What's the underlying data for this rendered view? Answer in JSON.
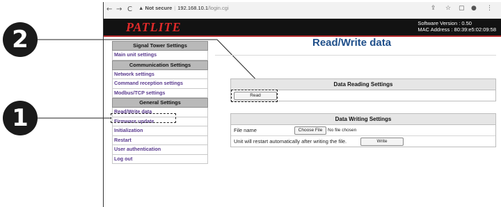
{
  "callouts": [
    "2",
    "1"
  ],
  "browser": {
    "nav": {
      "back": "←",
      "forward": "→",
      "reload": "C"
    },
    "security_label": "Not secure",
    "host": "192.168.10.1",
    "path": "/login.cgi",
    "toolbar_icons": [
      "share-icon",
      "star-icon",
      "sidebar-icon",
      "profile-icon",
      "menu-icon"
    ]
  },
  "header": {
    "logo": "PATLITE",
    "software_version": "Software Version : 0.50",
    "mac_address": "MAC Address : 80:39:e5:02:09:58"
  },
  "menu": {
    "sections": [
      {
        "title": "Signal Tower Settings",
        "items": [
          "Main unit settings"
        ]
      },
      {
        "title": "Communication Settings",
        "items": [
          "Network settings",
          "Command reception settings",
          "Modbus/TCP settings"
        ]
      },
      {
        "title": "General Settings",
        "items": [
          "Read/Write data",
          "Firmware update",
          "Initialization",
          "Restart",
          "User authentication",
          "Log out"
        ]
      }
    ]
  },
  "page_title": "Read/Write data",
  "reading": {
    "title": "Data Reading Settings",
    "read_button": "Read"
  },
  "writing": {
    "title": "Data Writing Settings",
    "file_label": "File name",
    "choose_file": "Choose File",
    "no_file": "No file chosen",
    "restart_note": "Unit will restart automatically after writing the file.",
    "write_button": "Write"
  }
}
